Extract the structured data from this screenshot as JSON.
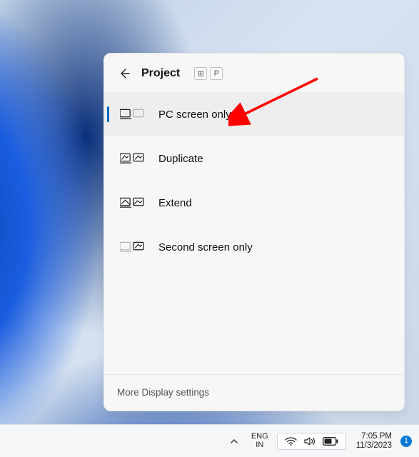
{
  "panel": {
    "title": "Project",
    "shortcut_keys": [
      "⊞",
      "P"
    ],
    "options": [
      {
        "label": "PC screen only",
        "selected": true
      },
      {
        "label": "Duplicate",
        "selected": false
      },
      {
        "label": "Extend",
        "selected": false
      },
      {
        "label": "Second screen only",
        "selected": false
      }
    ],
    "footer_link": "More Display settings"
  },
  "taskbar": {
    "language": {
      "line1": "ENG",
      "line2": "IN"
    },
    "clock": {
      "time": "7:05 PM",
      "date": "11/3/2023"
    },
    "notification_count": "1"
  }
}
